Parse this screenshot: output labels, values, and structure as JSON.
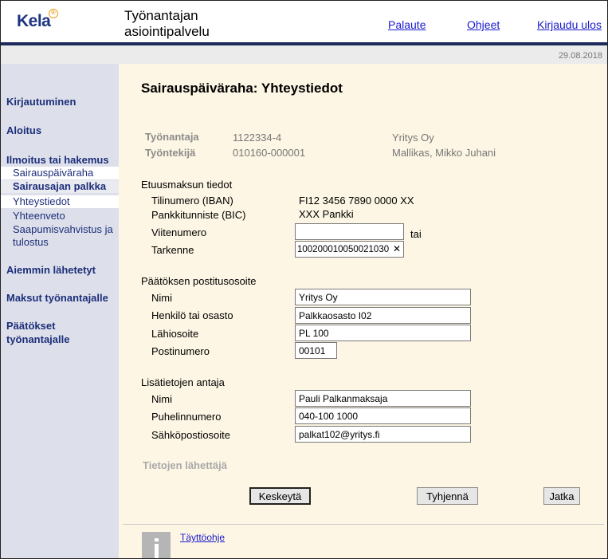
{
  "header": {
    "logo": "Kela",
    "app_title": "Työnantajan asiointipalvelu",
    "links": {
      "feedback": "Palaute",
      "help": "Ohjeet",
      "logout": "Kirjaudu ulos"
    },
    "date": "29.08.2018",
    "colors": {
      "brand": "#1d3580",
      "bar": "#1c2a5c",
      "link": "#1a1acc"
    }
  },
  "sidebar": {
    "login": "Kirjautuminen",
    "start": "Aloitus",
    "application": "Ilmoitus tai hakemus",
    "sub": {
      "sick_allowance": "Sairauspäiväraha",
      "sick_pay": "Sairausajan palkka",
      "contact": "Yhteystiedot",
      "summary": "Yhteenveto",
      "receipt": "Saapumisvahvistus ja tulostus"
    },
    "previous": "Aiemmin lähetetyt",
    "payments": "Maksut työnantajalle",
    "decisions": "Päätökset työnantajalle"
  },
  "main": {
    "title": "Sairauspäiväraha: Yhteystiedot",
    "employer": {
      "label": "Työnantaja",
      "id": "1122334-4",
      "name": "Yritys Oy"
    },
    "employee": {
      "label": "Työntekijä",
      "id": "010160-000001",
      "name": "Mallikas, Mikko Juhani"
    },
    "payment": {
      "heading": "Etuusmaksun tiedot",
      "iban_label": "Tilinumero (IBAN)",
      "iban": "FI12 3456 7890 0000 XX",
      "bic_label": "Pankkitunniste (BIC)",
      "bic": "XXX Pankki",
      "reference_label": "Viitenumero",
      "reference_value": "",
      "or": "tai",
      "specifier_label": "Tarkenne",
      "specifier_value": "100200010050021030"
    },
    "postal": {
      "heading": "Päätöksen postitusosoite",
      "name_label": "Nimi",
      "name": "Yritys Oy",
      "person_label": "Henkilö tai osasto",
      "person": "Palkkaosasto I02",
      "street_label": "Lähiosoite",
      "street": "PL 100",
      "zip_label": "Postinumero",
      "zip": "00101"
    },
    "info": {
      "heading": "Lisätietojen antaja",
      "name_label": "Nimi",
      "name": "Pauli Palkanmaksaja",
      "phone_label": "Puhelinnumero",
      "phone": "040-100 1000",
      "email_label": "Sähköpostiosoite",
      "email": "palkat102@yritys.fi"
    },
    "sender_heading": "Tietojen lähettäjä",
    "buttons": {
      "cancel": "Keskeytä",
      "clear": "Tyhjennä",
      "next": "Jatka"
    },
    "help_link": "Täyttöohje"
  }
}
